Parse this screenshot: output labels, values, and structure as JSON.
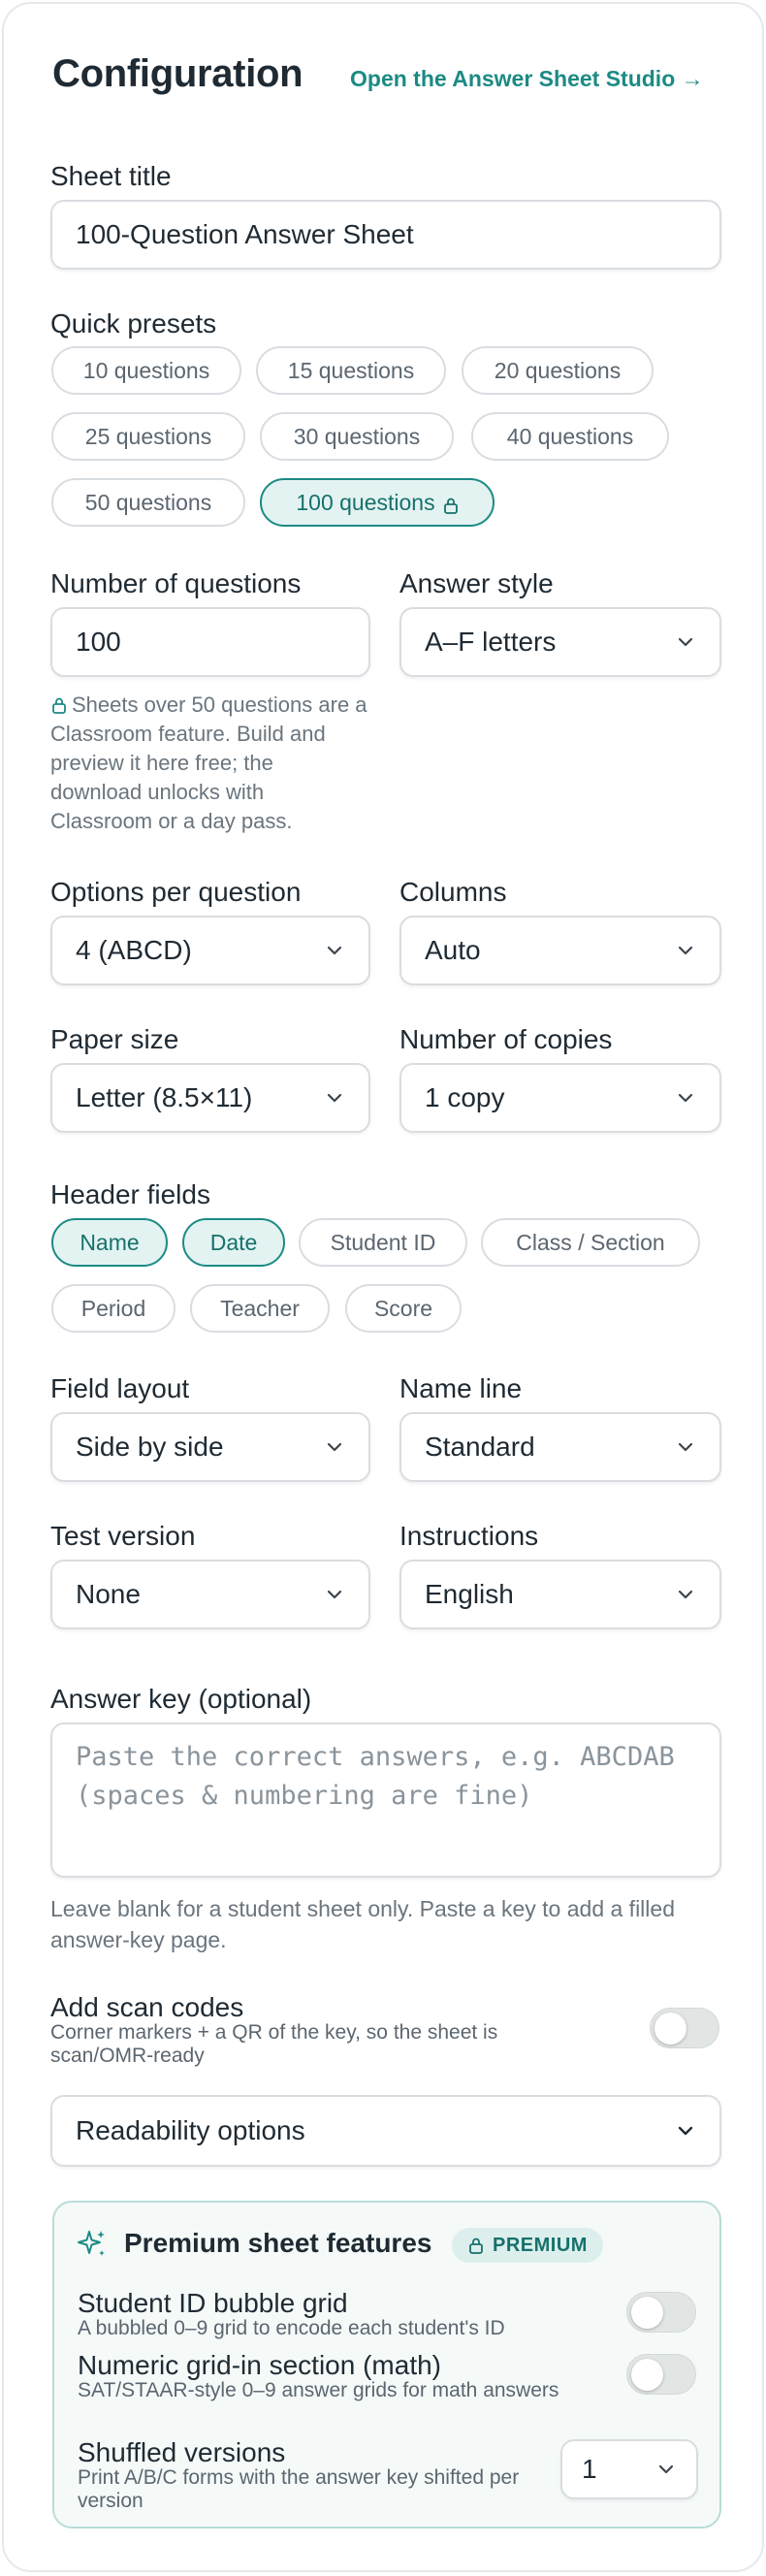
{
  "header": {
    "title": "Configuration",
    "studio_link": "Open the Answer Sheet Studio →"
  },
  "sheet_title": {
    "label": "Sheet title",
    "value": "100-Question Answer Sheet"
  },
  "presets": {
    "label": "Quick presets",
    "items": [
      "10 questions",
      "15 questions",
      "20 questions",
      "25 questions",
      "30 questions",
      "40 questions",
      "50 questions",
      "100 questions"
    ],
    "active": "100 questions"
  },
  "questions": {
    "label": "Number of questions",
    "value": "100",
    "note": "Sheets over 50 questions are a Classroom feature. Build and preview it here free; the download unlocks with Classroom or a day pass."
  },
  "answer_style": {
    "label": "Answer style",
    "value": "A–F letters"
  },
  "options_per_question": {
    "label": "Options per question",
    "value": "4 (ABCD)"
  },
  "columns": {
    "label": "Columns",
    "value": "Auto"
  },
  "paper_size": {
    "label": "Paper size",
    "value": "Letter (8.5×11)"
  },
  "copies": {
    "label": "Number of copies",
    "value": "1 copy"
  },
  "header_fields": {
    "label": "Header fields",
    "items": [
      "Name",
      "Date",
      "Student ID",
      "Class / Section",
      "Period",
      "Teacher",
      "Score"
    ],
    "active": [
      "Name",
      "Date"
    ]
  },
  "field_layout": {
    "label": "Field layout",
    "value": "Side by side"
  },
  "name_line": {
    "label": "Name line",
    "value": "Standard"
  },
  "test_version": {
    "label": "Test version",
    "value": "None"
  },
  "instructions": {
    "label": "Instructions",
    "value": "English"
  },
  "answer_key": {
    "label": "Answer key (optional)",
    "placeholder": "Paste the correct answers, e.g. ABCDAB  (spaces & numbering are fine)",
    "note": "Leave blank for a student sheet only. Paste a key to add a filled answer-key page."
  },
  "scan_codes": {
    "title": "Add scan codes",
    "desc": "Corner markers + a QR of the key, so the sheet is scan/OMR-ready",
    "enabled": false
  },
  "readability": {
    "label": "Readability options"
  },
  "premium": {
    "title": "Premium sheet features",
    "badge": "PREMIUM",
    "features": [
      {
        "title": "Student ID bubble grid",
        "desc": "A bubbled 0–9 grid to encode each student's ID",
        "enabled": false
      },
      {
        "title": "Numeric grid-in section (math)",
        "desc": "SAT/STAAR-style 0–9 answer grids for math answers",
        "enabled": false
      },
      {
        "title": "Shuffled versions",
        "desc": "Print A/B/C forms with the answer key shifted per version",
        "value": "1"
      }
    ]
  },
  "colors": {
    "accent": "#1c8a84",
    "accent_bg": "#e3f3f1",
    "border": "#d9dde1"
  },
  "icons": {
    "chevron": "chevron-down-icon",
    "lock": "lock-icon",
    "sparkle": "sparkle-icon"
  }
}
